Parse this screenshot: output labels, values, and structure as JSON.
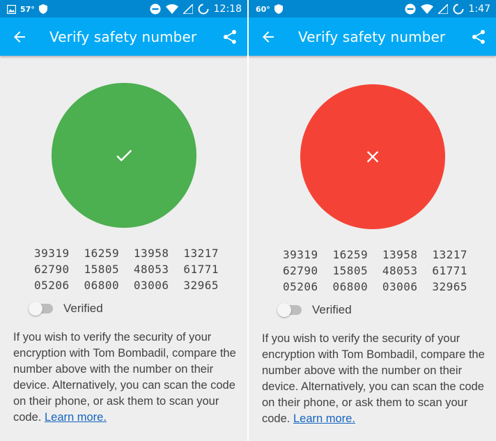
{
  "screens": [
    {
      "status": {
        "temperature": "57°",
        "time": "12:18"
      },
      "title": "Verify safety number",
      "state": "verified-match",
      "circle_color": "#4caf50",
      "safety_number": [
        [
          "39319",
          "16259",
          "13958",
          "13217"
        ],
        [
          "62790",
          "15805",
          "48053",
          "61771"
        ],
        [
          "05206",
          "06800",
          "03006",
          "32965"
        ]
      ],
      "verified_label": "Verified",
      "verified_on": false,
      "description": "If you wish to verify the security of your encryption with Tom Bombadil, compare the number above with the number on their device. Alternatively, you can scan the code on their phone, or ask them to scan your code.",
      "learn_more": "Learn more."
    },
    {
      "status": {
        "temperature": "60°",
        "time": "1:47"
      },
      "title": "Verify safety number",
      "state": "mismatch",
      "circle_color": "#f44336",
      "safety_number": [
        [
          "39319",
          "16259",
          "13958",
          "13217"
        ],
        [
          "62790",
          "15805",
          "48053",
          "61771"
        ],
        [
          "05206",
          "06800",
          "03006",
          "32965"
        ]
      ],
      "verified_label": "Verified",
      "verified_on": false,
      "description": "If you wish to verify the security of your encryption with Tom Bombadil, compare the number above with the number on their device. Alternatively, you can scan the code on their phone, or ask them to scan your code.",
      "learn_more": "Learn more."
    }
  ],
  "colors": {
    "appbar": "#03a9f4",
    "statusbar": "#0288d1",
    "background": "#eeeeee",
    "link": "#1565c0"
  },
  "icons": [
    "image-icon",
    "shield-icon",
    "dnd-icon",
    "wifi-icon",
    "signal-icon",
    "battery-icon",
    "back-arrow-icon",
    "share-icon",
    "checkmark-icon",
    "x-mark-icon"
  ]
}
